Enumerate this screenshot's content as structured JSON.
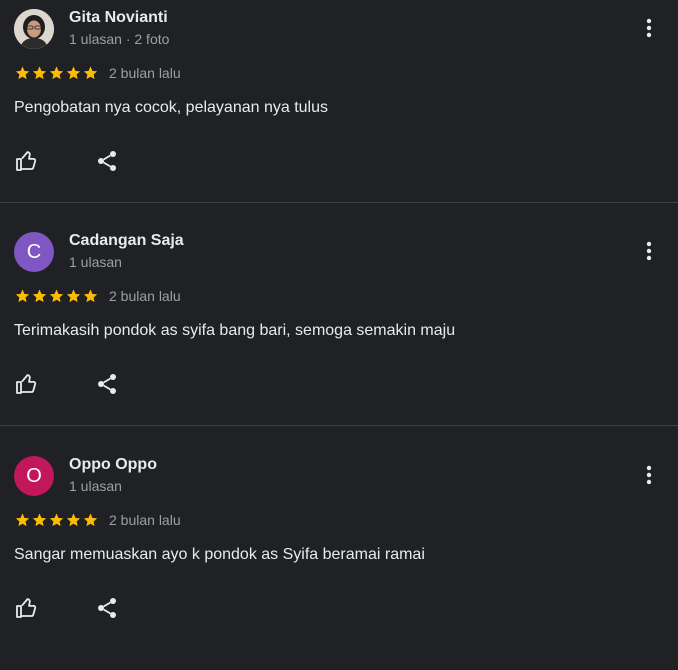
{
  "colors": {
    "background": "#202124",
    "star": "#fbbc04",
    "text_primary": "#e8eaed",
    "text_secondary": "#9aa0a6",
    "divider": "#3c4043"
  },
  "reviews": [
    {
      "name": "Gita Novianti",
      "meta": "1 ulasan · 2 foto",
      "avatar_type": "photo",
      "avatar_letter": "",
      "avatar_color": "#d9d2c9",
      "rating": 5,
      "date": "2 bulan lalu",
      "text": "Pengobatan nya cocok, pelayanan nya tulus"
    },
    {
      "name": "Cadangan Saja",
      "meta": "1 ulasan",
      "avatar_type": "letter",
      "avatar_letter": "C",
      "avatar_color": "#7e57c2",
      "rating": 5,
      "date": "2 bulan lalu",
      "text": "Terimakasih pondok as syifa bang bari, semoga semakin maju"
    },
    {
      "name": "Oppo Oppo",
      "meta": "1 ulasan",
      "avatar_type": "letter",
      "avatar_letter": "O",
      "avatar_color": "#c2185b",
      "rating": 5,
      "date": "2 bulan lalu",
      "text": "Sangar memuaskan ayo k pondok as Syifa beramai ramai"
    }
  ],
  "icons": {
    "more": "more-vert-icon",
    "like": "thumb-up-icon",
    "share": "share-icon",
    "star": "star-icon"
  }
}
